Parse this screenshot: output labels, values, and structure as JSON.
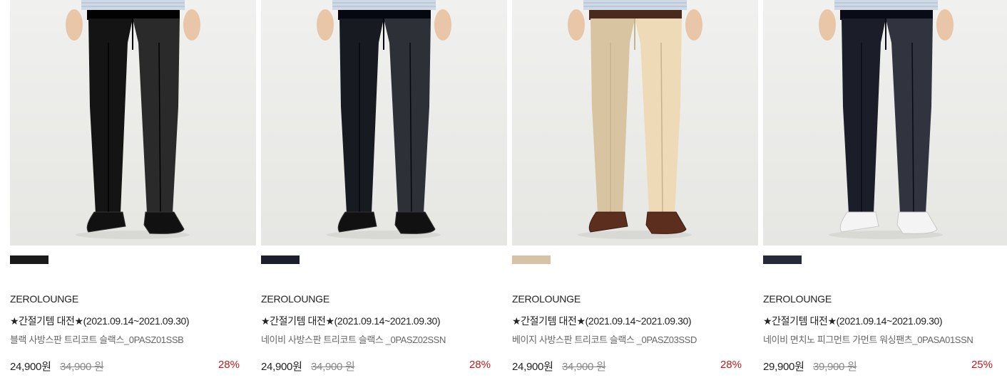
{
  "products": [
    {
      "image_label": "black-slacks-model-photo",
      "swatch_color": "#1a1a1a",
      "pant_color": "#141414",
      "shoe_type": "dark",
      "shirt": true,
      "brand": "ZEROLOUNGE",
      "promo": "★간절기템 대전★(2021.09.14~2021.09.30)",
      "name": "블랙 사방스판 트리코트 슬랙스_0PASZ01SSB",
      "price": "24,900원",
      "original_price": "34,900 원",
      "discount": "28%"
    },
    {
      "image_label": "navy-slacks-model-photo",
      "swatch_color": "#1c1f2b",
      "pant_color": "#181a22",
      "shoe_type": "dark",
      "shirt": true,
      "brand": "ZEROLOUNGE",
      "promo": "★간절기템 대전★(2021.09.14~2021.09.30)",
      "name": "네이비 사방스판 트리코트 슬랙스 _0PASZ02SSN",
      "price": "24,900원",
      "original_price": "34,900 원",
      "discount": "28%"
    },
    {
      "image_label": "beige-slacks-model-photo",
      "swatch_color": "#d6c3a5",
      "pant_color": "#d9c4a2",
      "shoe_type": "brown",
      "shirt": true,
      "brand": "ZEROLOUNGE",
      "promo": "★간절기템 대전★(2021.09.14~2021.09.30)",
      "name": "베이지 사방스판 트리코트 슬랙스 _0PASZ03SSD",
      "price": "24,900원",
      "original_price": "34,900 원",
      "discount": "28%"
    },
    {
      "image_label": "navy-cotton-pants-model-photo",
      "swatch_color": "#262a36",
      "pant_color": "#1b1e28",
      "shoe_type": "white",
      "shirt": true,
      "brand": "ZEROLOUNGE",
      "promo": "★간절기템 대전★(2021.09.14~2021.09.30)",
      "name": "네이비 면치노 피그먼트 가먼트 워싱팬츠_0PASA01SSN",
      "price": "29,900원",
      "original_price": "39,900 원",
      "discount": "25%"
    }
  ]
}
